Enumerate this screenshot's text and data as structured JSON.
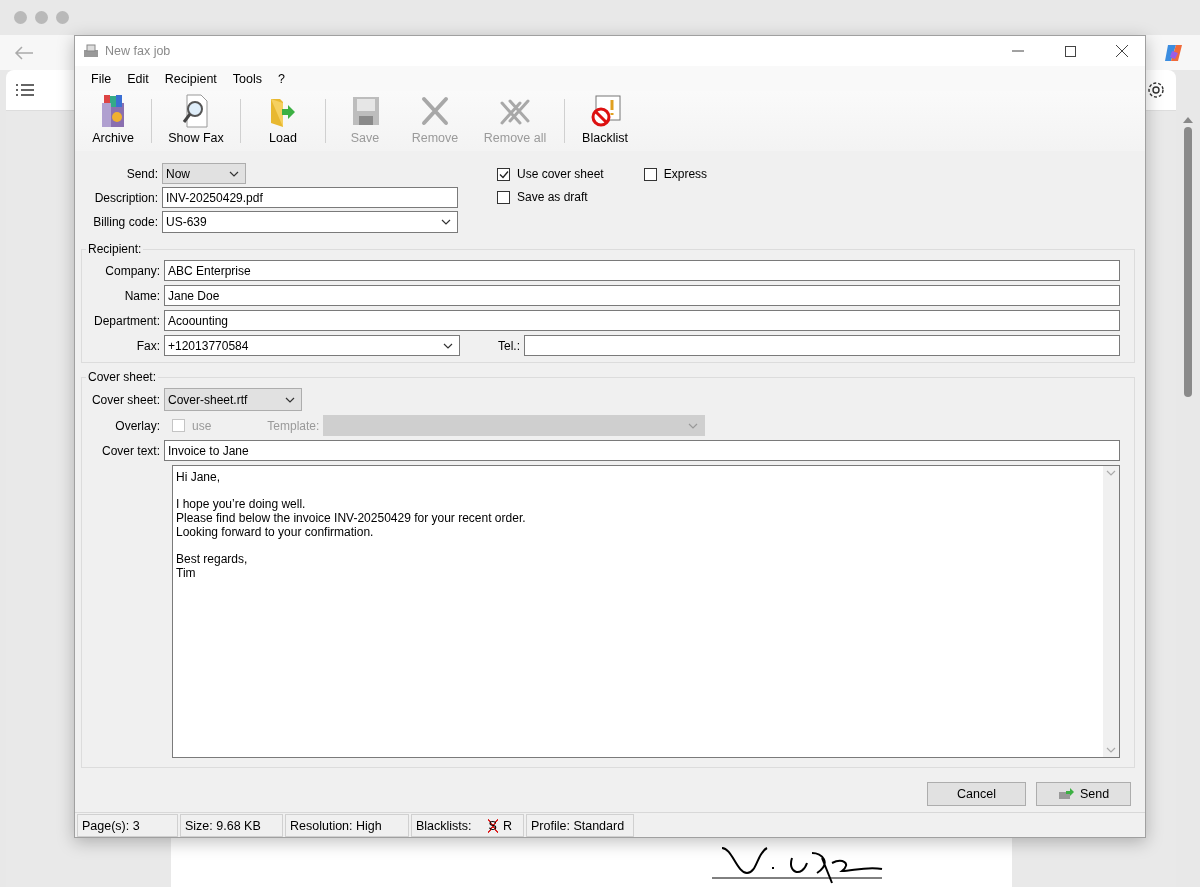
{
  "window": {
    "title": "New fax job"
  },
  "menu": [
    "File",
    "Edit",
    "Recipient",
    "Tools",
    "?"
  ],
  "toolbar": [
    {
      "label": "Archive",
      "kind": "archive",
      "disabled": false
    },
    {
      "label": "Show Fax",
      "kind": "show_fax",
      "disabled": false
    },
    {
      "label": "Load",
      "kind": "load",
      "disabled": false
    },
    {
      "label": "Save",
      "kind": "save",
      "disabled": true
    },
    {
      "label": "Remove",
      "kind": "remove",
      "disabled": true
    },
    {
      "label": "Remove all",
      "kind": "remove_all",
      "disabled": true
    },
    {
      "label": "Blacklist",
      "kind": "blacklist",
      "disabled": false
    }
  ],
  "send": {
    "label": "Send:",
    "value": "Now"
  },
  "description": {
    "label": "Description:",
    "value": "INV-20250429.pdf"
  },
  "billing_code": {
    "label": "Billing code:",
    "value": "US-639"
  },
  "options": [
    {
      "label": "Use cover sheet",
      "checked": true
    },
    {
      "label": "Save as draft",
      "checked": false
    },
    {
      "label": "Express",
      "checked": false
    }
  ],
  "recipient": {
    "title": "Recipient:",
    "fields": [
      {
        "label": "Company:",
        "value": "ABC Enterprise"
      },
      {
        "label": "Name:",
        "value": "Jane Doe"
      },
      {
        "label": "Department:",
        "value": "Acoounting"
      }
    ],
    "fax": {
      "label": "Fax:",
      "value": "+12013770584"
    },
    "tel": {
      "label": "Tel.:"
    }
  },
  "cover_sheet": {
    "title": "Cover sheet:",
    "file": {
      "label": "Cover sheet:",
      "value": "Cover-sheet.rtf"
    },
    "overlay": {
      "label": "Overlay:",
      "checkbox_label": "use",
      "checked": false,
      "disabled": true
    },
    "template": {
      "label": "Template:",
      "disabled": true
    },
    "cover_text": {
      "label": "Cover text:",
      "value": "Invoice to Jane"
    },
    "body": [
      [
        "Hi Jane,"
      ],
      [
        "I hope you’re doing well.",
        "Please find below the invoice INV-20250429 for your recent order.",
        "Looking forward to your confirmation."
      ],
      [
        "Best regards,",
        "Tim"
      ]
    ]
  },
  "buttons": [
    {
      "label": "Cancel",
      "kind": "plain"
    },
    {
      "label": "Send",
      "kind": "send"
    }
  ],
  "status_bar": {
    "pages": "Page(s): 3",
    "size": "Size: 9.68 KB",
    "resolution": "Resolution: High",
    "blacklists_label": "Blacklists:",
    "blacklists": [
      {
        "letter": "S",
        "crossed": true
      },
      {
        "letter": "R",
        "crossed": false
      }
    ],
    "profile": "Profile: Standard"
  }
}
